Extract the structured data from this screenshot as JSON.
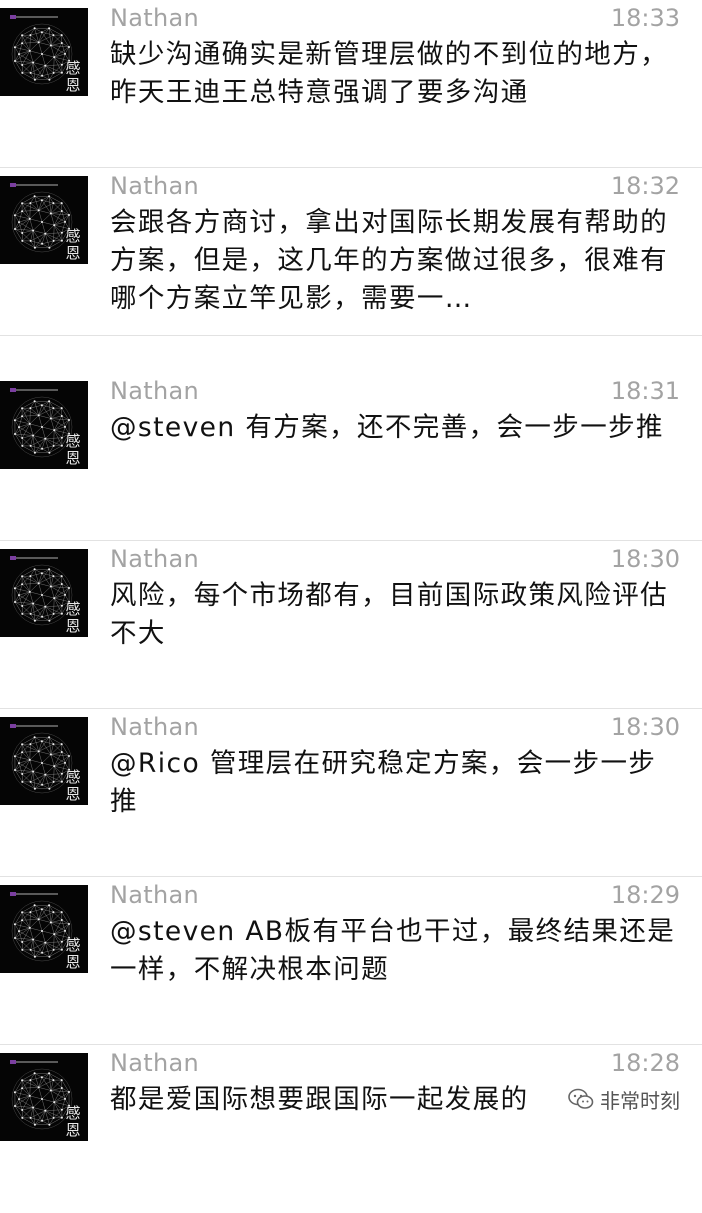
{
  "messages": [
    {
      "name": "Nathan",
      "time": "18:33",
      "text": "缺少沟通确实是新管理层做的不到位的地方，昨天王迪王总特意强调了要多沟通"
    },
    {
      "name": "Nathan",
      "time": "18:32",
      "text": "会跟各方商讨，拿出对国际长期发展有帮助的方案，但是，这几年的方案做过很多，很难有哪个方案立竿见影，需要一…"
    },
    {
      "name": "Nathan",
      "time": "18:31",
      "text": "@steven 有方案，还不完善，会一步一步推"
    },
    {
      "name": "Nathan",
      "time": "18:30",
      "text": "风险，每个市场都有，目前国际政策风险评估不大"
    },
    {
      "name": "Nathan",
      "time": "18:30",
      "text": "@Rico 管理层在研究稳定方案，会一步一步推"
    },
    {
      "name": "Nathan",
      "time": "18:29",
      "text": "@steven AB板有平台也干过，最终结果还是一样，不解决根本问题"
    },
    {
      "name": "Nathan",
      "time": "18:28",
      "text": "都是爱国际想要跟国际一起发展的"
    }
  ],
  "avatar": {
    "badge_top": "感",
    "badge_bottom": "恩",
    "icon": "geodesic-globe-icon"
  },
  "watermark": {
    "label": "非常时刻",
    "icon": "wechat-channel-icon"
  },
  "colors": {
    "background": "#ffffff",
    "text": "#111111",
    "meta": "#a3a3a3",
    "divider": "#e2e2e2"
  }
}
